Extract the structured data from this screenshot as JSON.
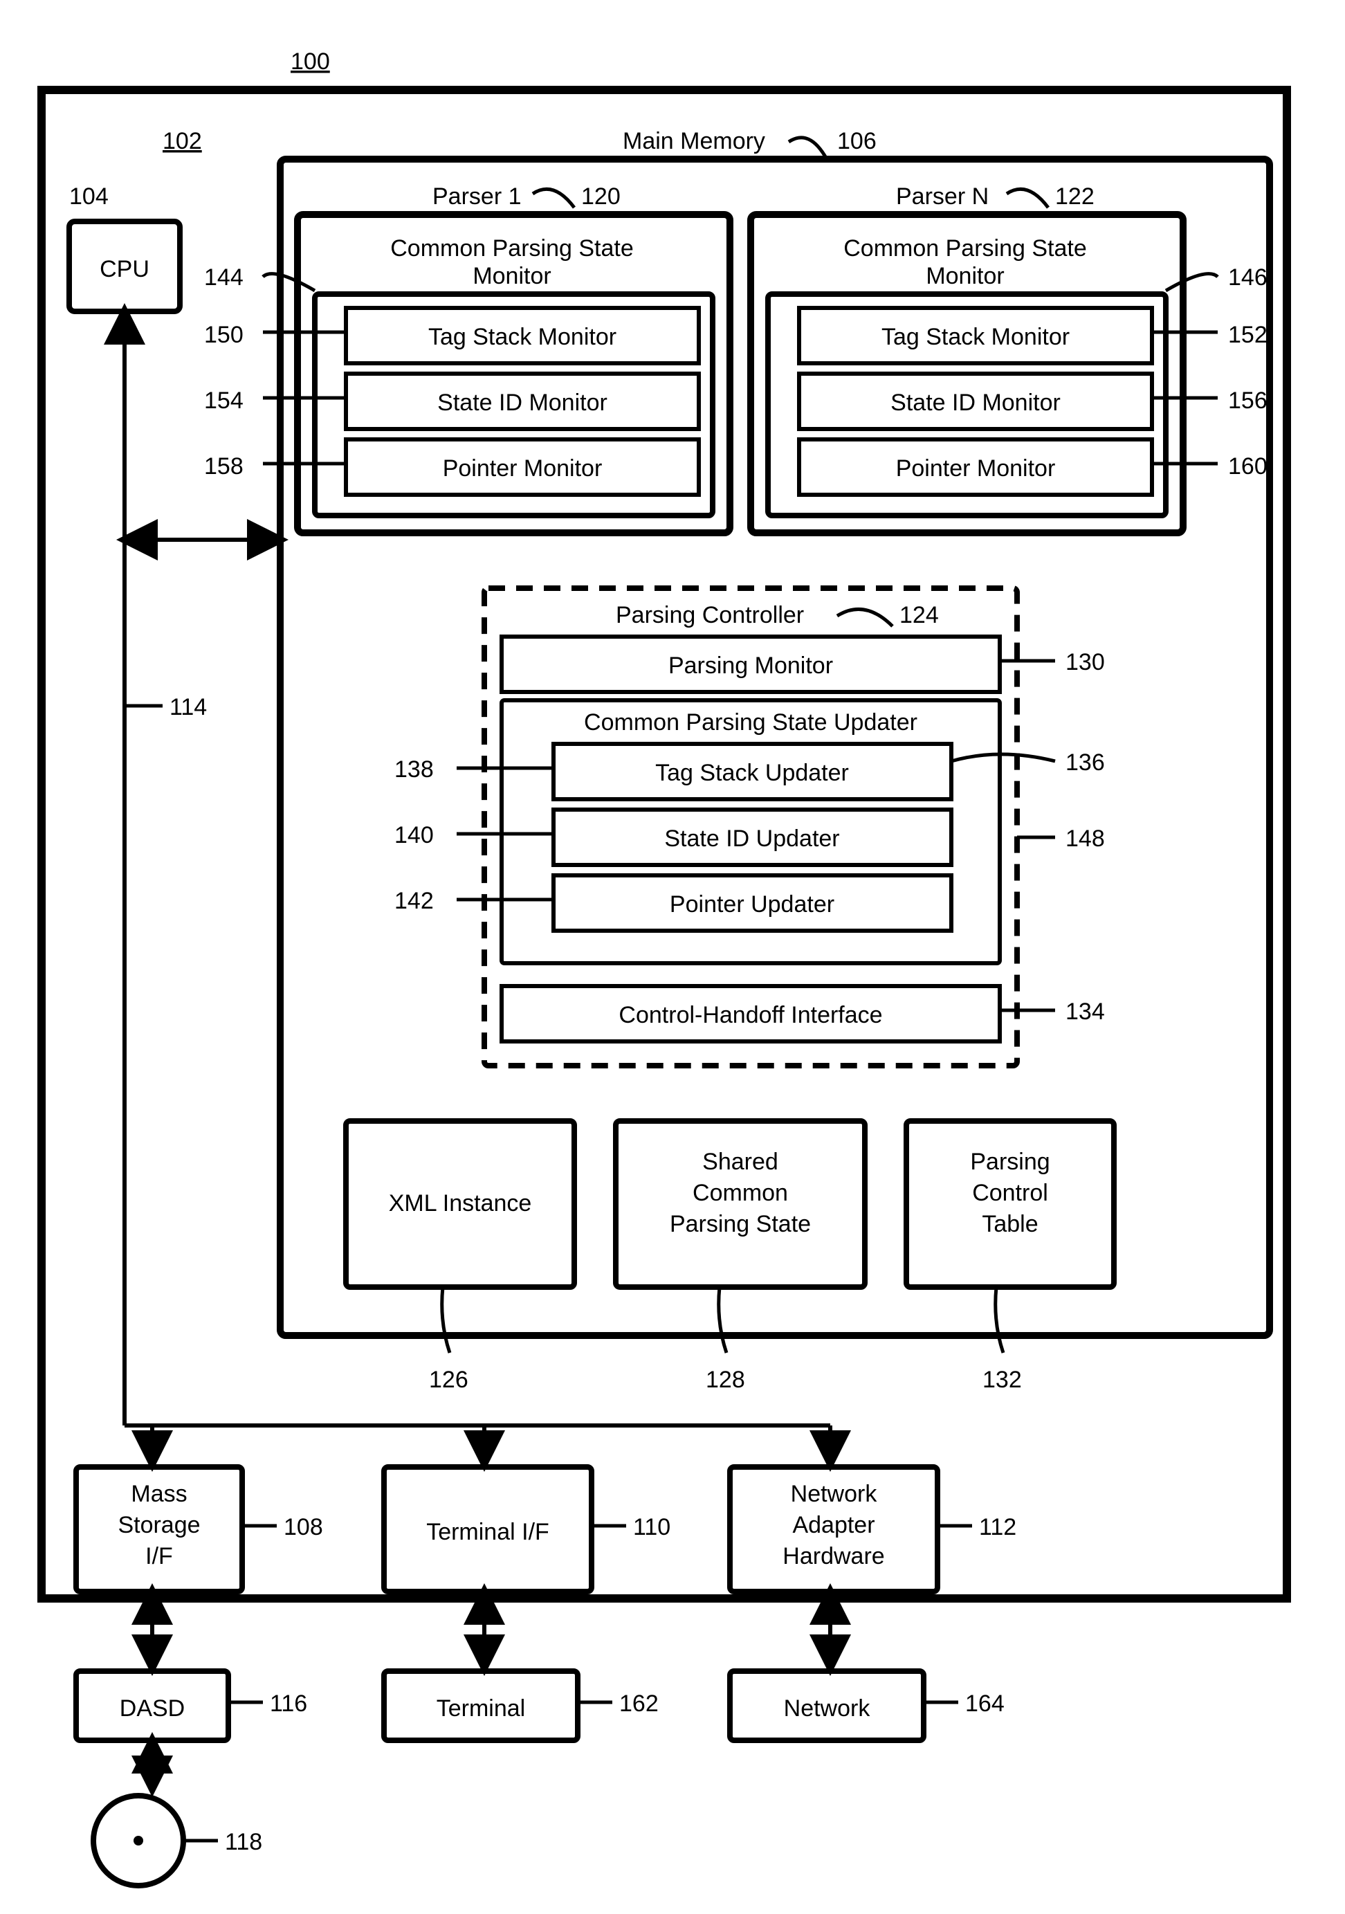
{
  "refs": {
    "system": "100",
    "board": "102",
    "cpu": "104",
    "mem": "106",
    "mass_if": "108",
    "term_if": "110",
    "net_hw": "112",
    "bus": "114",
    "dasd": "116",
    "disk": "118",
    "p1": "120",
    "pn": "122",
    "pc": "124",
    "xml": "126",
    "scps": "128",
    "pmon": "130",
    "pct": "132",
    "chi": "134",
    "cpsu": "136",
    "tsu": "138",
    "siu": "140",
    "pu": "142",
    "csm1": "144",
    "csm2": "146",
    "cpsu_group": "148",
    "tsm1": "150",
    "tsm2": "152",
    "sim1": "154",
    "sim2": "156",
    "pm1": "158",
    "pm2": "160",
    "terminal": "162",
    "network": "164"
  },
  "labels": {
    "cpu": "CPU",
    "mem": "Main Memory",
    "p1": "Parser 1",
    "pn": "Parser N",
    "csm": "Common Parsing State\nMonitor",
    "tsm": "Tag Stack Monitor",
    "sim": "State ID Monitor",
    "pm": "Pointer Monitor",
    "pc": "Parsing Controller",
    "pmon": "Parsing Monitor",
    "cpsu": "Common Parsing State Updater",
    "tsu": "Tag Stack Updater",
    "siu": "State ID Updater",
    "pu": "Pointer Updater",
    "chi": "Control-Handoff Interface",
    "xml": "XML Instance",
    "scps": "Shared\nCommon\nParsing State",
    "pct": "Parsing\nControl\nTable",
    "mass_if": "Mass\nStorage\nI/F",
    "term_if": "Terminal I/F",
    "net_hw": "Network\nAdapter\nHardware",
    "dasd": "DASD",
    "terminal": "Terminal",
    "network": "Network"
  }
}
